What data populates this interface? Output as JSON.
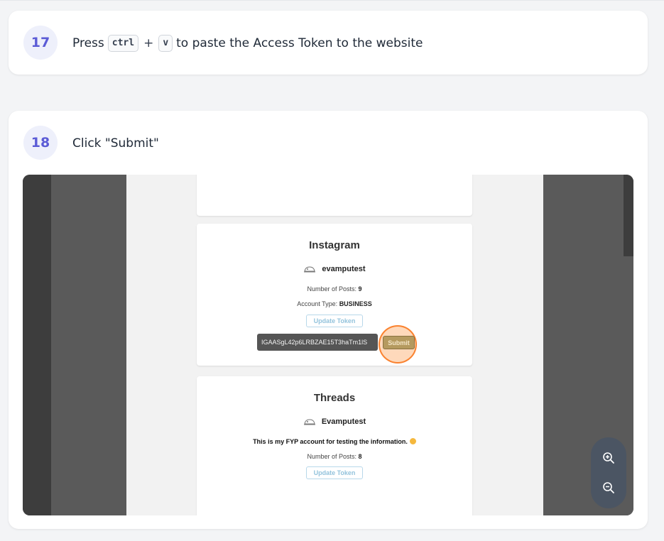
{
  "steps": [
    {
      "number": "17",
      "text_before": "Press",
      "key1": "ctrl",
      "plus": "+",
      "key2": "v",
      "text_after": "to paste the Access Token to the website"
    },
    {
      "number": "18",
      "text": "Click \"Submit\""
    }
  ],
  "screenshot": {
    "instagram": {
      "title": "Instagram",
      "username": "evamputest",
      "posts_label": "Number of Posts:",
      "posts_value": "9",
      "account_type_label": "Account Type:",
      "account_type_value": "BUSINESS",
      "update_button": "Update Token",
      "token_value": "IGAASgL42p6LRBZAE15T3haTm1lS",
      "submit_button": "Submit"
    },
    "threads": {
      "title": "Threads",
      "username": "Evamputest",
      "bio": "This is my FYP account for testing the information.",
      "posts_label": "Number of Posts:",
      "posts_value": "8",
      "update_button": "Update Token"
    }
  },
  "icons": {
    "avatar": "avatar-icon",
    "zoom_in": "zoom-in-icon",
    "zoom_out": "zoom-out-icon"
  },
  "colors": {
    "badge_bg": "#eef0fb",
    "badge_text": "#5b5bd6",
    "highlight": "#f97316"
  }
}
